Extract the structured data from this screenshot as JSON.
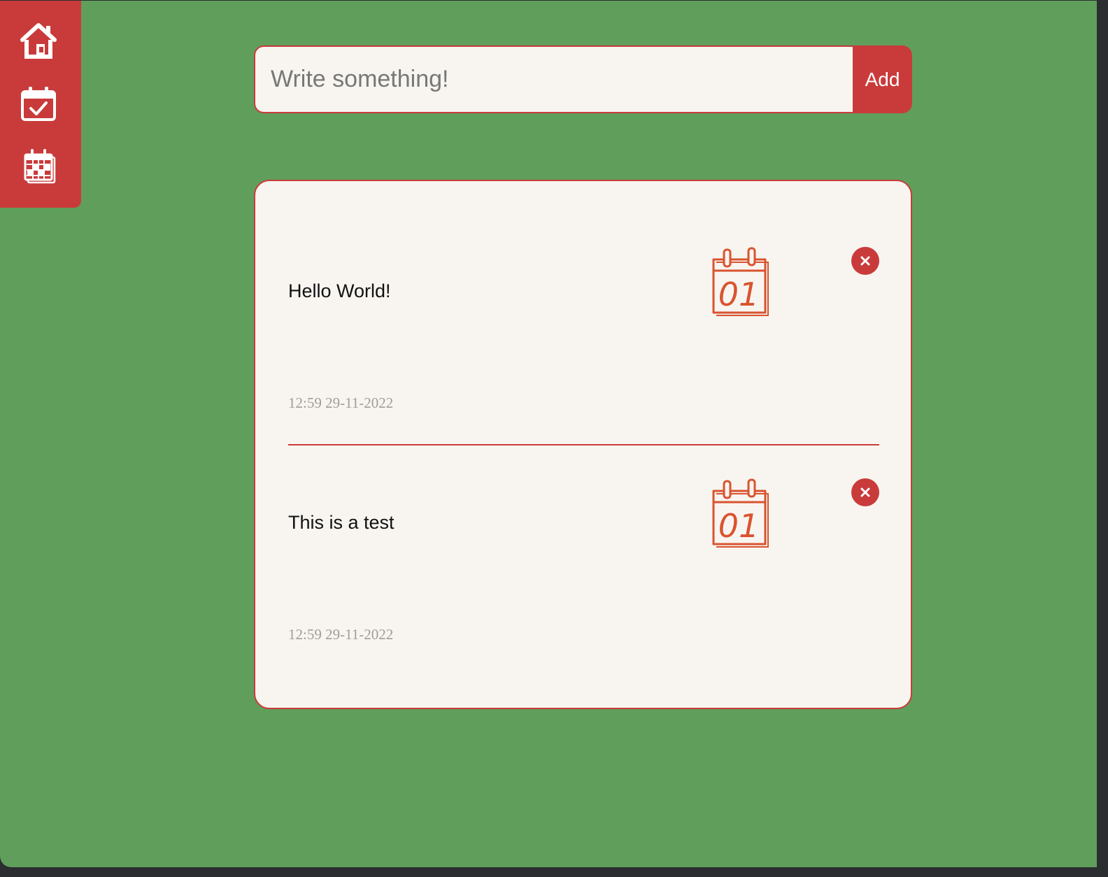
{
  "sidebar": {
    "items": [
      {
        "name": "home",
        "icon": "home-icon"
      },
      {
        "name": "todos",
        "icon": "calendar-check-icon"
      },
      {
        "name": "calendar",
        "icon": "calendar-grid-icon"
      }
    ]
  },
  "add_form": {
    "placeholder": "Write something!",
    "value": "",
    "button_label": "Add"
  },
  "todos": [
    {
      "text": "Hello World!",
      "date": "12:59 29-11-2022",
      "calendar_day": "01",
      "calendar_icon": "calendar-01-icon",
      "delete_icon": "close-icon"
    },
    {
      "text": "This is a test",
      "date": "12:59 29-11-2022",
      "calendar_day": "01",
      "calendar_icon": "calendar-01-icon",
      "delete_icon": "close-icon"
    }
  ],
  "colors": {
    "background": "#609e5c",
    "accent": "#c93b3a",
    "card": "#f8f5f0",
    "calendar_icon": "#d9542f",
    "date_text": "#a19c97"
  }
}
